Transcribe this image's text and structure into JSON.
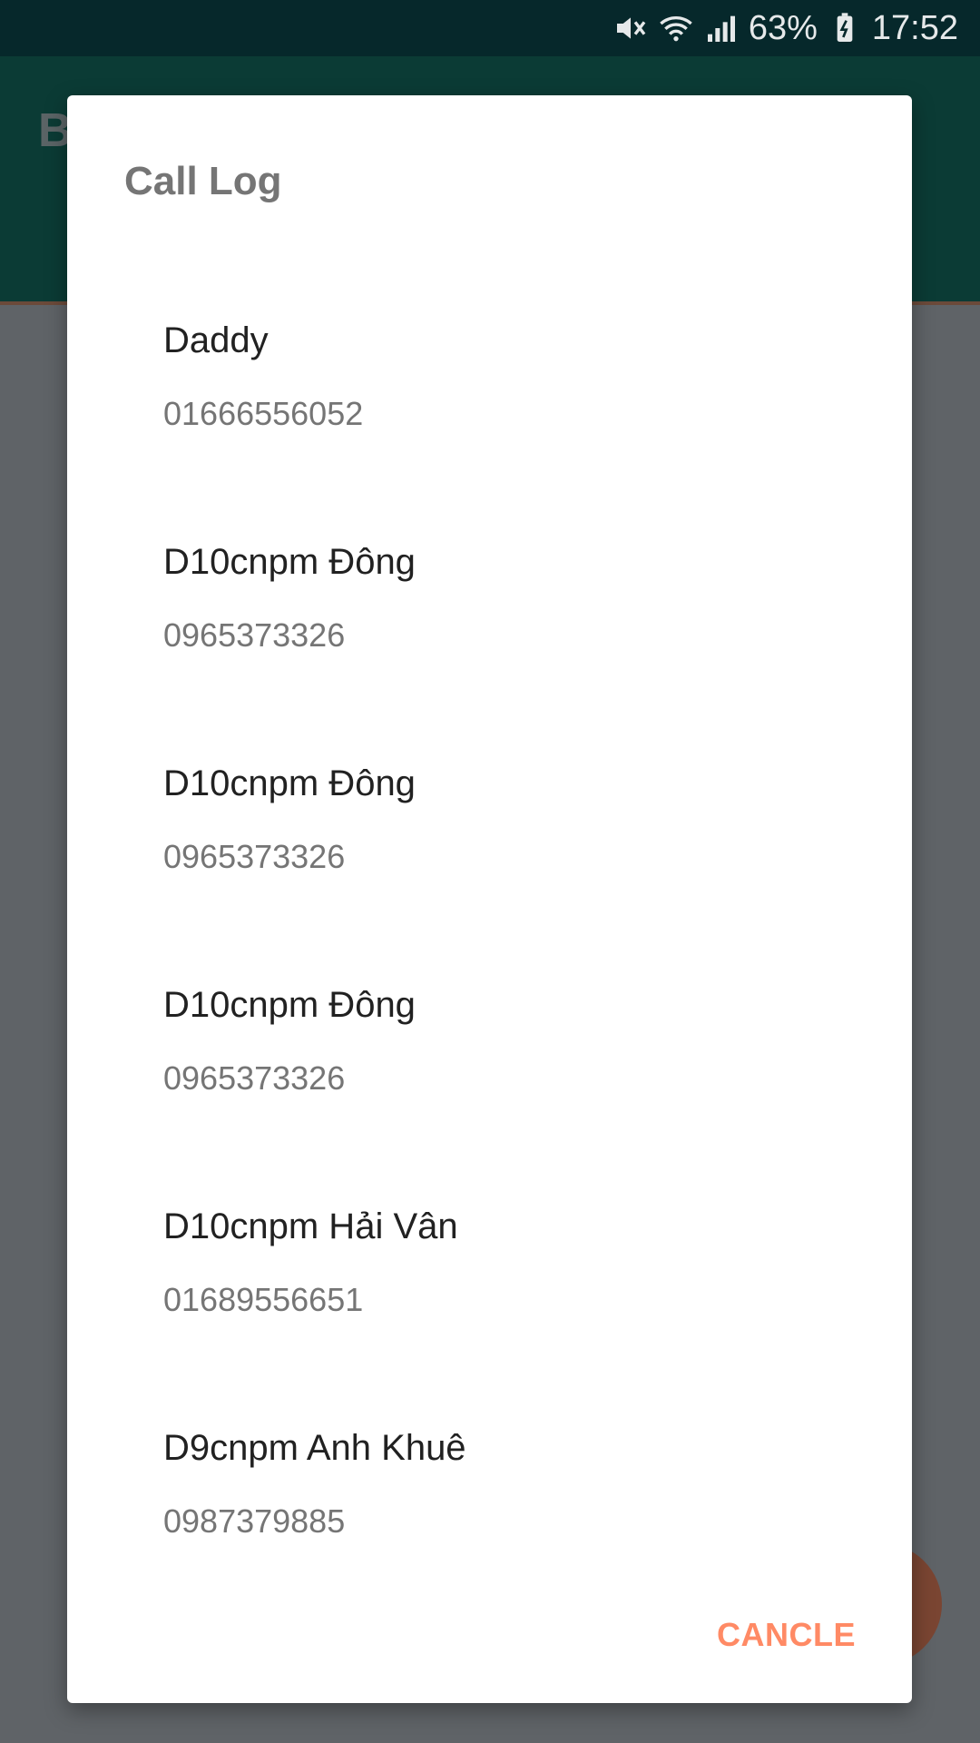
{
  "status_bar": {
    "battery": "63%",
    "time": "17:52",
    "icons": [
      "mute-vibrate-icon",
      "wifi-icon",
      "signal-icon",
      "battery-icon"
    ]
  },
  "background": {
    "app_title_initial": "B"
  },
  "dialog": {
    "title": "Call Log",
    "entries": [
      {
        "name": "Daddy",
        "number": "01666556052"
      },
      {
        "name": "D10cnpm Đông",
        "number": "0965373326"
      },
      {
        "name": "D10cnpm Đông",
        "number": "0965373326"
      },
      {
        "name": "D10cnpm Đông",
        "number": "0965373326"
      },
      {
        "name": "D10cnpm Hải Vân",
        "number": "01689556651"
      },
      {
        "name": "D9cnpm Anh Khuê",
        "number": "0987379885"
      }
    ],
    "cancel_label": "CANCLE"
  },
  "colors": {
    "status_bar": "#06282b",
    "header": "#0b3b35",
    "scrim": "#5f6367",
    "accent": "#ff8a65"
  }
}
